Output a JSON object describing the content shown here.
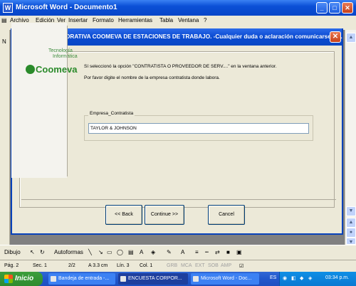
{
  "word": {
    "title": "Microsoft Word - Documento1",
    "menu": [
      "Archivo",
      "Edición",
      "Ver",
      "Insertar",
      "Formato",
      "Herramientas",
      "Tabla",
      "Ventana",
      "?"
    ],
    "left_label": "N",
    "drawbar": {
      "dibujo": "Dibujo",
      "autoformas": "Autoformas"
    },
    "status": {
      "page": "Pág. 2",
      "section": "Sec. 1",
      "pages": "2/2",
      "at": "A 3.3 cm",
      "line": "Lín. 3",
      "col": "Col. 1",
      "grb": "GRB",
      "mca": "MCA",
      "ext": "EXT",
      "sob": "SOB",
      "amp": "AMP"
    }
  },
  "dialog": {
    "title": "ENCUESTA CORPORATIVA COOMEVA DE ESTACIONES DE TRABAJO.  -Cualquier duda o aclaración comunicarse a ...",
    "logo": {
      "line1": "Tecnología",
      "line2": "Informática",
      "brand": "Coomeva"
    },
    "message1": "Sí seleccionó la opción \"CONTRATISTA O PROVEEDOR DE SERV....\" en la ventana anterior.",
    "message2": "Por favor digite el nombre de la empresa contratista donde labora.",
    "group_label": "Empresa_Contratista",
    "empresa_value": "TAYLOR & JOHNSON",
    "buttons": {
      "back": "<< Back",
      "continue": "Continue >>",
      "cancel": "Cancel"
    }
  },
  "taskbar": {
    "start": "Inicio",
    "tasks": [
      "Bandeja de entrada -...",
      "ENCUESTA CORPOR...",
      "Microsoft Word - Doc..."
    ],
    "lang": "ES",
    "time": "03:34 p.m."
  },
  "colors": {
    "titlebar": "#0a4fd6",
    "taskbar": "#2157cc",
    "start": "#2e8b2e",
    "brand_green": "#2a8a2a"
  }
}
